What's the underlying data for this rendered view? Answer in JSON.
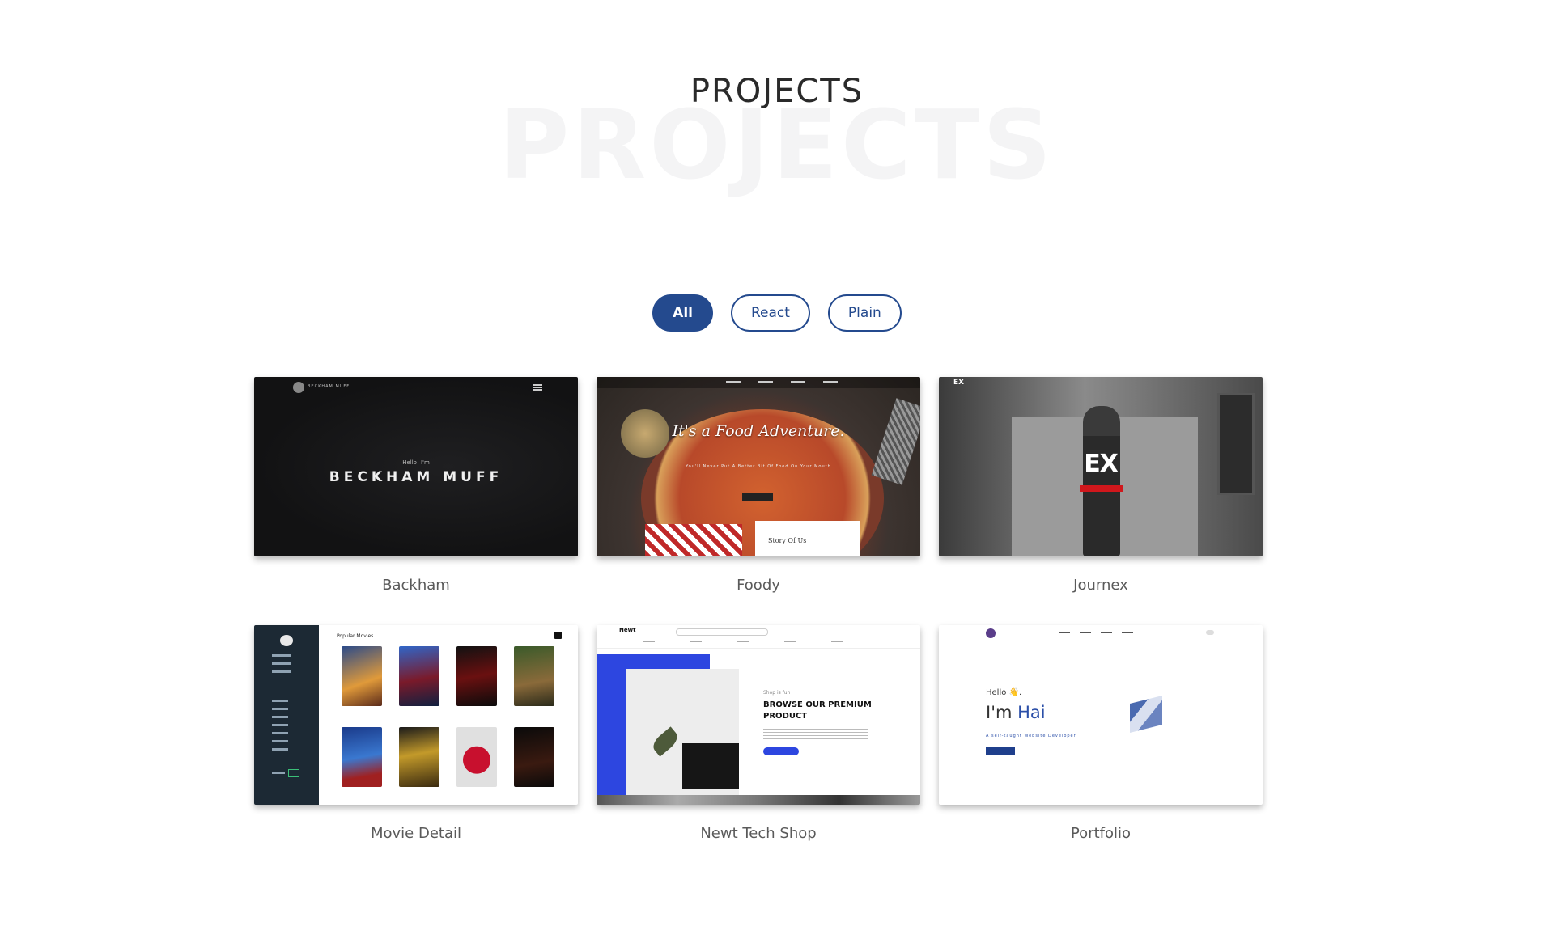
{
  "header": {
    "title": "PROJECTS",
    "background_title": "PROJECTS"
  },
  "filters": [
    {
      "label": "All",
      "active": true
    },
    {
      "label": "React",
      "active": false
    },
    {
      "label": "Plain",
      "active": false
    }
  ],
  "projects": [
    {
      "name": "Backham",
      "thumb": {
        "logo_text": "BECKHAM MUFF",
        "hello": "Hello! I'm",
        "name": "BECKHAM MUFF"
      }
    },
    {
      "name": "Foody",
      "thumb": {
        "headline": "It's a Food Adventure.",
        "sub": "You'll Never Put A Better Bit Of Food On Your Mouth",
        "story": "Story Of Us"
      }
    },
    {
      "name": "Journex",
      "thumb": {
        "corner": "EX",
        "big": "EX"
      }
    },
    {
      "name": "Movie Detail",
      "thumb": {
        "section": "Popular Movies"
      }
    },
    {
      "name": "Newt Tech Shop",
      "thumb": {
        "brand": "Newt",
        "kicker": "Shop is fun",
        "hero": "BROWSE OUR PREMIUM PRODUCT"
      }
    },
    {
      "name": "Portfolio",
      "thumb": {
        "hello": "Hello 👋.",
        "im": "I'm ",
        "im_name": "Hai",
        "tag": "A self-taught Website Developer"
      }
    }
  ],
  "colors": {
    "accent": "#244a8e",
    "card_title": "#5a5a5a"
  }
}
